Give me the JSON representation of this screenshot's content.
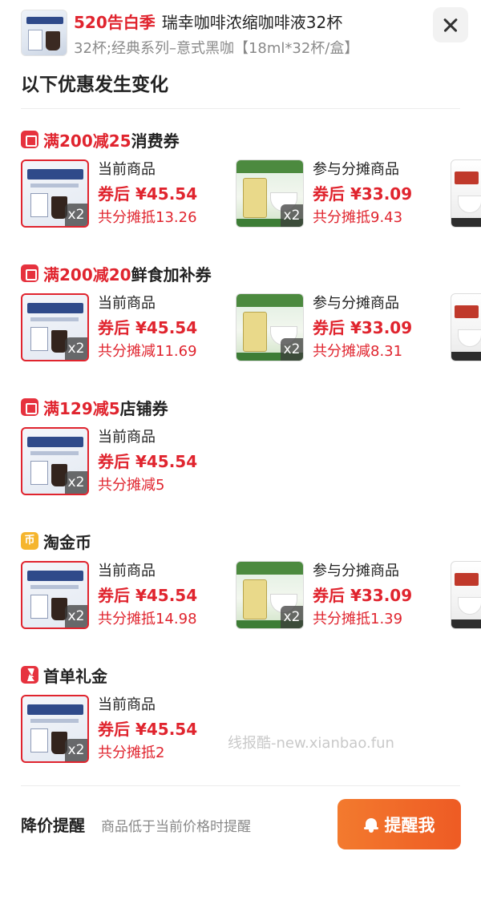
{
  "header": {
    "promo_tag": "520告白季",
    "title": "瑞幸咖啡浓缩咖啡液32杯",
    "spec": "32杯;经典系列–意式黑咖【18ml*32杯/盒】",
    "heading": "以下优惠发生变化"
  },
  "sections": [
    {
      "title_highlight": "满200减25",
      "title_suffix": "消费券",
      "icon": "coupon-icon",
      "current": {
        "label": "当前商品",
        "price": "券后 ¥45.54",
        "share": "共分摊抵13.26",
        "qty": "x2"
      },
      "shared": {
        "label": "参与分摊商品",
        "price": "券后 ¥33.09",
        "share": "共分摊抵9.43",
        "qty": "x2"
      }
    },
    {
      "title_highlight": "满200减20",
      "title_suffix": "鲜食加补券",
      "icon": "coupon-icon",
      "current": {
        "label": "当前商品",
        "price": "券后 ¥45.54",
        "share": "共分摊减11.69",
        "qty": "x2"
      },
      "shared": {
        "label": "参与分摊商品",
        "price": "券后 ¥33.09",
        "share": "共分摊减8.31",
        "qty": "x2"
      }
    },
    {
      "title_highlight": "满129减5",
      "title_suffix": "店铺券",
      "icon": "store-icon",
      "current": {
        "label": "当前商品",
        "price": "券后 ¥45.54",
        "share": "共分摊减5",
        "qty": "x2"
      }
    },
    {
      "title_highlight": "",
      "title_suffix": "淘金币",
      "icon": "coin-icon",
      "icon_glyph": "币",
      "current": {
        "label": "当前商品",
        "price": "券后 ¥45.54",
        "share": "共分摊抵14.98",
        "qty": "x2"
      },
      "shared": {
        "label": "参与分摊商品",
        "price": "券后 ¥33.09",
        "share": "共分摊抵1.39",
        "qty": "x2"
      }
    },
    {
      "title_highlight": "",
      "title_suffix": "首单礼金",
      "icon": "lightning-icon",
      "current": {
        "label": "当前商品",
        "price": "券后 ¥45.54",
        "share": "共分摊抵2",
        "qty": "x2"
      }
    }
  ],
  "watermark": "线报酷-new.xianbao.fun",
  "footer": {
    "alert_title": "降价提醒",
    "alert_desc": "商品低于当前价格时提醒",
    "remind_label": "提醒我"
  },
  "colors": {
    "accent_red": "#e0242e",
    "button_orange": "#ef6429",
    "coin_gold": "#f5b52e"
  }
}
